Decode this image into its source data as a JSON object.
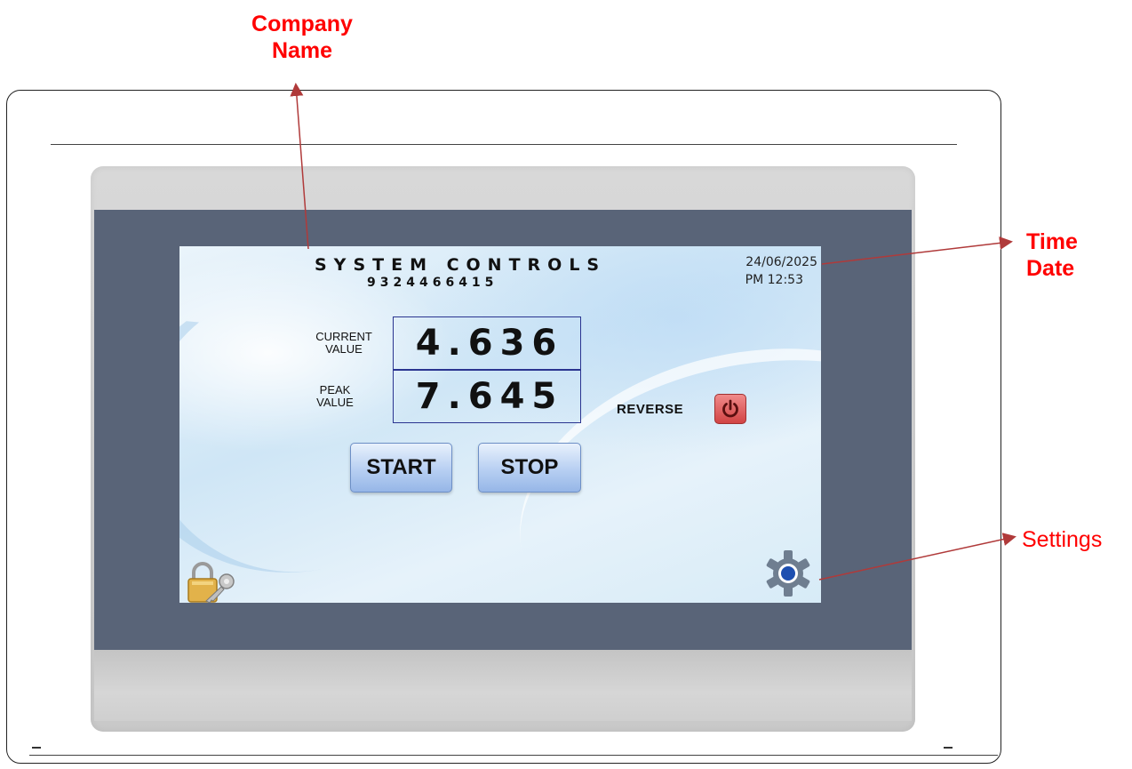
{
  "annotations": {
    "company_line1": "Company",
    "company_line2": "Name",
    "time_line1": "Time",
    "time_line2": "Date",
    "settings": "Settings"
  },
  "screen": {
    "company_title": "SYSTEM CONTROLS",
    "company_phone": "9324466415",
    "date": "24/06/2025",
    "time": "PM 12:53",
    "current_label_line1": "CURRENT",
    "current_label_line2": "VALUE",
    "current_value": "4.636",
    "peak_label_line1": "PEAK",
    "peak_label_line2": "VALUE",
    "peak_value": "7.645",
    "reverse_label": "REVERSE",
    "start_label": "START",
    "stop_label": "STOP"
  },
  "icons": {
    "reverse": "power-icon",
    "lock": "lock-key-icon",
    "settings": "gear-icon"
  },
  "colors": {
    "annotation": "#ff0000",
    "arrow": "#b03a3a",
    "bezel_panel": "#596478",
    "value_border": "#2a3490",
    "reverse_button": "#d24444",
    "button_blue": "#b7cff2"
  }
}
